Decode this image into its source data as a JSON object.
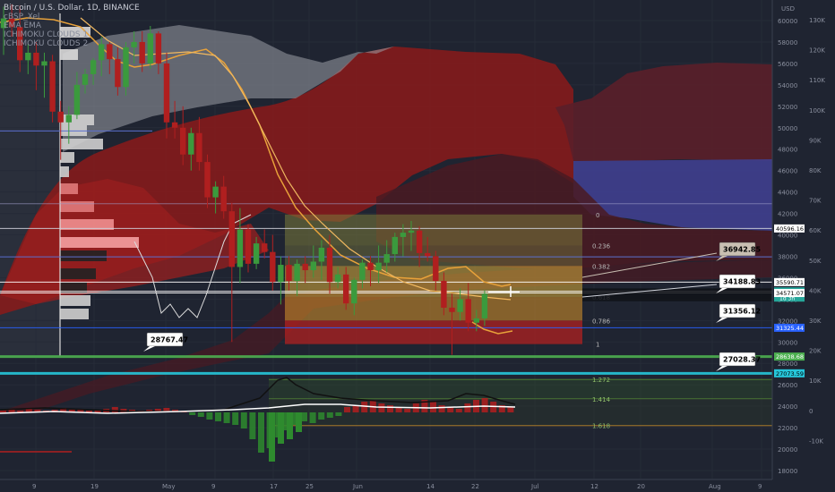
{
  "header": {
    "symbol": "Bitcoin / U.S. Dollar, 1D, BINANCE",
    "indicators": [
      "cBSP_Xel",
      "EMA EMA",
      "ICHIMOKU CLOUDS 1",
      "ICHIMOKU CLOUDS 2"
    ]
  },
  "chart_data": {
    "type": "candlestick",
    "title": "Bitcoin / U.S. Dollar, 1D, BINANCE",
    "currency": "USD",
    "price_axis": {
      "unit": "USD",
      "range": [
        17000,
        61500
      ],
      "ticks": [
        60000,
        58000,
        56000,
        54000,
        52000,
        50000,
        48000,
        46000,
        44000,
        42000,
        40000,
        38000,
        36000,
        34000,
        32000,
        30000,
        28000,
        26000,
        24000,
        22000,
        20000,
        18000
      ]
    },
    "secondary_axis": {
      "ticks": [
        "130K",
        "120K",
        "110K",
        "100K",
        "90K",
        "80K",
        "70K",
        "60K",
        "50K",
        "40K",
        "30K",
        "20K",
        "10K",
        "0",
        "-10K"
      ]
    },
    "x_axis_labels": [
      "9",
      "19",
      "May",
      "9",
      "17",
      "25",
      "Jun",
      "14",
      "22",
      "Jul",
      "12",
      "20",
      "Aug",
      "9"
    ],
    "candles": [
      {
        "o": 59300,
        "h": 61300,
        "l": 56800,
        "c": 60200
      },
      {
        "o": 60200,
        "h": 61500,
        "l": 58500,
        "c": 59400
      },
      {
        "o": 59400,
        "h": 61400,
        "l": 55200,
        "c": 56300
      },
      {
        "o": 56300,
        "h": 57800,
        "l": 55000,
        "c": 57000
      },
      {
        "o": 57000,
        "h": 58000,
        "l": 53500,
        "c": 55800
      },
      {
        "o": 55800,
        "h": 57000,
        "l": 52800,
        "c": 56200
      },
      {
        "o": 56200,
        "h": 56800,
        "l": 50500,
        "c": 51500
      },
      {
        "o": 51500,
        "h": 52500,
        "l": 47000,
        "c": 50500
      },
      {
        "o": 50500,
        "h": 52000,
        "l": 48500,
        "c": 51200
      },
      {
        "o": 51200,
        "h": 55200,
        "l": 50800,
        "c": 54000
      },
      {
        "o": 54000,
        "h": 55500,
        "l": 53200,
        "c": 55000
      },
      {
        "o": 55000,
        "h": 56500,
        "l": 54000,
        "c": 56300
      },
      {
        "o": 56300,
        "h": 58500,
        "l": 54800,
        "c": 57800
      },
      {
        "o": 57800,
        "h": 58000,
        "l": 55000,
        "c": 56400
      },
      {
        "o": 56400,
        "h": 57500,
        "l": 53000,
        "c": 53800
      },
      {
        "o": 53800,
        "h": 58000,
        "l": 53000,
        "c": 57500
      },
      {
        "o": 57500,
        "h": 59000,
        "l": 56000,
        "c": 58000
      },
      {
        "o": 58000,
        "h": 59000,
        "l": 55200,
        "c": 56000
      },
      {
        "o": 56000,
        "h": 59500,
        "l": 55500,
        "c": 58800
      },
      {
        "o": 58800,
        "h": 59000,
        "l": 55000,
        "c": 56000
      },
      {
        "o": 56000,
        "h": 57000,
        "l": 49000,
        "c": 50500
      },
      {
        "o": 50500,
        "h": 52500,
        "l": 49000,
        "c": 50000
      },
      {
        "o": 50000,
        "h": 52000,
        "l": 46500,
        "c": 47500
      },
      {
        "o": 47500,
        "h": 50000,
        "l": 46000,
        "c": 49500
      },
      {
        "o": 49500,
        "h": 51000,
        "l": 46000,
        "c": 46800
      },
      {
        "o": 46800,
        "h": 47500,
        "l": 42500,
        "c": 43500
      },
      {
        "o": 43500,
        "h": 45000,
        "l": 42000,
        "c": 44500
      },
      {
        "o": 44500,
        "h": 45500,
        "l": 41500,
        "c": 42200
      },
      {
        "o": 42200,
        "h": 43000,
        "l": 30000,
        "c": 37000
      },
      {
        "o": 37000,
        "h": 42500,
        "l": 35500,
        "c": 40500
      },
      {
        "o": 40500,
        "h": 41000,
        "l": 36500,
        "c": 37300
      },
      {
        "o": 37300,
        "h": 39800,
        "l": 36800,
        "c": 39200
      },
      {
        "o": 39200,
        "h": 40500,
        "l": 37800,
        "c": 38400
      },
      {
        "o": 38400,
        "h": 40000,
        "l": 34800,
        "c": 35600
      },
      {
        "o": 35600,
        "h": 38000,
        "l": 33500,
        "c": 37200
      },
      {
        "o": 37200,
        "h": 38000,
        "l": 34800,
        "c": 35700
      },
      {
        "o": 35700,
        "h": 37700,
        "l": 34300,
        "c": 37300
      },
      {
        "o": 37300,
        "h": 38000,
        "l": 35500,
        "c": 36700
      },
      {
        "o": 36700,
        "h": 39000,
        "l": 36000,
        "c": 37500
      },
      {
        "o": 37500,
        "h": 39500,
        "l": 35800,
        "c": 38800
      },
      {
        "o": 38800,
        "h": 40000,
        "l": 34500,
        "c": 35600
      },
      {
        "o": 35600,
        "h": 37000,
        "l": 35000,
        "c": 36300
      },
      {
        "o": 36300,
        "h": 37000,
        "l": 33000,
        "c": 33600
      },
      {
        "o": 33600,
        "h": 36000,
        "l": 32500,
        "c": 35800
      },
      {
        "o": 35800,
        "h": 37700,
        "l": 35000,
        "c": 37400
      },
      {
        "o": 37400,
        "h": 38000,
        "l": 35200,
        "c": 36700
      },
      {
        "o": 36700,
        "h": 39000,
        "l": 35500,
        "c": 37400
      },
      {
        "o": 37400,
        "h": 39500,
        "l": 36500,
        "c": 38200
      },
      {
        "o": 38200,
        "h": 40200,
        "l": 37500,
        "c": 39800
      },
      {
        "o": 39800,
        "h": 41000,
        "l": 38000,
        "c": 40200
      },
      {
        "o": 40200,
        "h": 41300,
        "l": 38500,
        "c": 40400
      },
      {
        "o": 40400,
        "h": 40800,
        "l": 37000,
        "c": 38300
      },
      {
        "o": 38300,
        "h": 39800,
        "l": 37500,
        "c": 38000
      },
      {
        "o": 38000,
        "h": 38500,
        "l": 34800,
        "c": 35700
      },
      {
        "o": 35700,
        "h": 36500,
        "l": 32500,
        "c": 33200
      },
      {
        "o": 33200,
        "h": 34500,
        "l": 28800,
        "c": 32800
      },
      {
        "o": 32800,
        "h": 35000,
        "l": 32000,
        "c": 34000
      },
      {
        "o": 34000,
        "h": 35500,
        "l": 31000,
        "c": 31800
      },
      {
        "o": 31800,
        "h": 33000,
        "l": 31000,
        "c": 32200
      },
      {
        "o": 32200,
        "h": 34800,
        "l": 31500,
        "c": 34500
      }
    ],
    "fibonacci_levels": [
      {
        "label": "0",
        "price": 41900
      },
      {
        "label": "0.236",
        "price": 39000
      },
      {
        "label": "0.382",
        "price": 37100
      },
      {
        "label": "0.618",
        "price": 34200
      },
      {
        "label": "0.786",
        "price": 32000
      },
      {
        "label": "1",
        "price": 29800
      },
      {
        "label": "1.272",
        "price": 26500
      },
      {
        "label": "1.414",
        "price": 24700
      },
      {
        "label": "1.618",
        "price": 22200
      }
    ],
    "horizontal_levels": [
      40596.16,
      35590.71,
      34726.57,
      34571.07,
      31325.44,
      28638.68,
      27073.59
    ],
    "price_labels": [
      {
        "text": "40596.16",
        "value": 40596.16,
        "bg": "#ffffff",
        "fg": "#000000"
      },
      {
        "text": "35590.71",
        "value": 35590.71,
        "bg": "#ffffff",
        "fg": "#000000"
      },
      {
        "text": "34726.57",
        "value": 34726.57,
        "bg": "#26a69a",
        "fg": "#ffffff",
        "sub": "1d 3h"
      },
      {
        "text": "34571.07",
        "value": 34571.07,
        "bg": "#ffffff",
        "fg": "#000000"
      },
      {
        "text": "31325.44",
        "value": 31325.44,
        "bg": "#2962ff",
        "fg": "#ffffff"
      },
      {
        "text": "28638.68",
        "value": 28638.68,
        "bg": "#4caf50",
        "fg": "#ffffff"
      },
      {
        "text": "27073.59",
        "value": 27073.59,
        "bg": "#26c6da",
        "fg": "#000000"
      }
    ],
    "callouts": [
      {
        "text": "36942.85",
        "value": 36942.85,
        "style": "dark"
      },
      {
        "text": "34188.83",
        "value": 34188.83,
        "style": "light"
      },
      {
        "text": "31356.12",
        "value": 31356.12,
        "style": "light"
      },
      {
        "text": "28767.47",
        "value": 28767.47,
        "style": "light"
      },
      {
        "text": "27028.37",
        "value": 27028.37,
        "style": "light"
      }
    ]
  },
  "colors": {
    "background": "#1f2431",
    "bull": "#3b9a3d",
    "bear": "#b01f1f",
    "cloud_red": "#8b1a1a",
    "cloud_blue": "#3f3f8f",
    "ema": "#e8a23a"
  }
}
